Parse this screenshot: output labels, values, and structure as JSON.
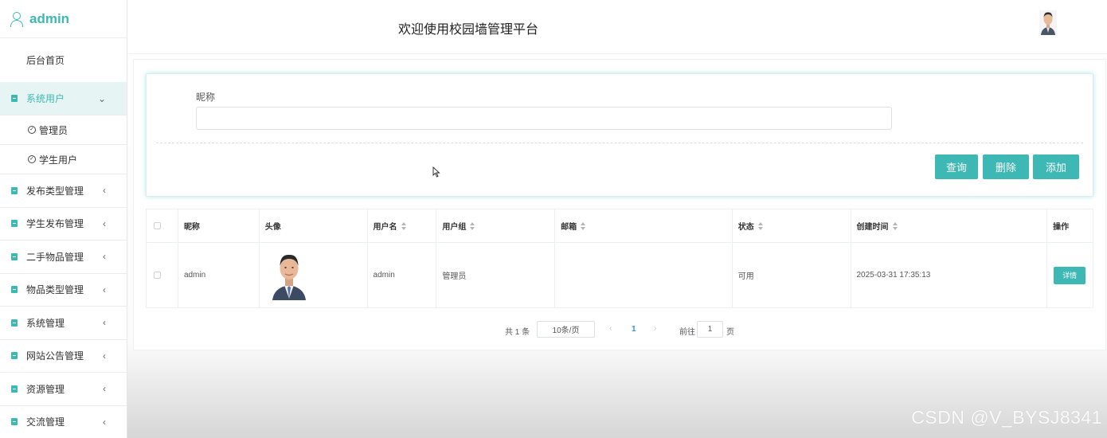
{
  "sidebar": {
    "brand": "admin",
    "home": "后台首页",
    "items": [
      {
        "label": "系统用户",
        "arrow": "⌄",
        "active": true
      },
      {
        "label": "发布类型管理",
        "arrow": "‹"
      },
      {
        "label": "学生发布管理",
        "arrow": "‹"
      },
      {
        "label": "二手物品管理",
        "arrow": "‹"
      },
      {
        "label": "物品类型管理",
        "arrow": "‹"
      },
      {
        "label": "系统管理",
        "arrow": "‹"
      },
      {
        "label": "网站公告管理",
        "arrow": "‹"
      },
      {
        "label": "资源管理",
        "arrow": "‹"
      },
      {
        "label": "交流管理",
        "arrow": "‹"
      }
    ],
    "subitems": [
      {
        "label": "管理员"
      },
      {
        "label": "学生用户"
      }
    ]
  },
  "header": {
    "welcome": "欢迎使用校园墙管理平台"
  },
  "search": {
    "nickname_label": "昵称",
    "nickname_value": "",
    "query_button": "查询",
    "delete_button": "删除",
    "add_button": "添加"
  },
  "table": {
    "columns": [
      "昵称",
      "头像",
      "用户名",
      "用户组",
      "邮箱",
      "状态",
      "创建时间",
      "操作"
    ],
    "rows": [
      {
        "nickname": "admin",
        "username": "admin",
        "group": "管理员",
        "email": "",
        "status": "可用",
        "created": "2025-03-31 17:35:13",
        "action": "详情"
      }
    ]
  },
  "pager": {
    "total": "共 1 条",
    "page_size": "10条/页",
    "prev": "‹",
    "current_page": "1",
    "next": "›",
    "goto_label": "前往",
    "goto_value": "1",
    "page_unit": "页"
  },
  "watermark": "CSDN @V_BYSJ8341",
  "colors": {
    "accent": "#3db8b5",
    "page_link": "#3a8ee6"
  }
}
